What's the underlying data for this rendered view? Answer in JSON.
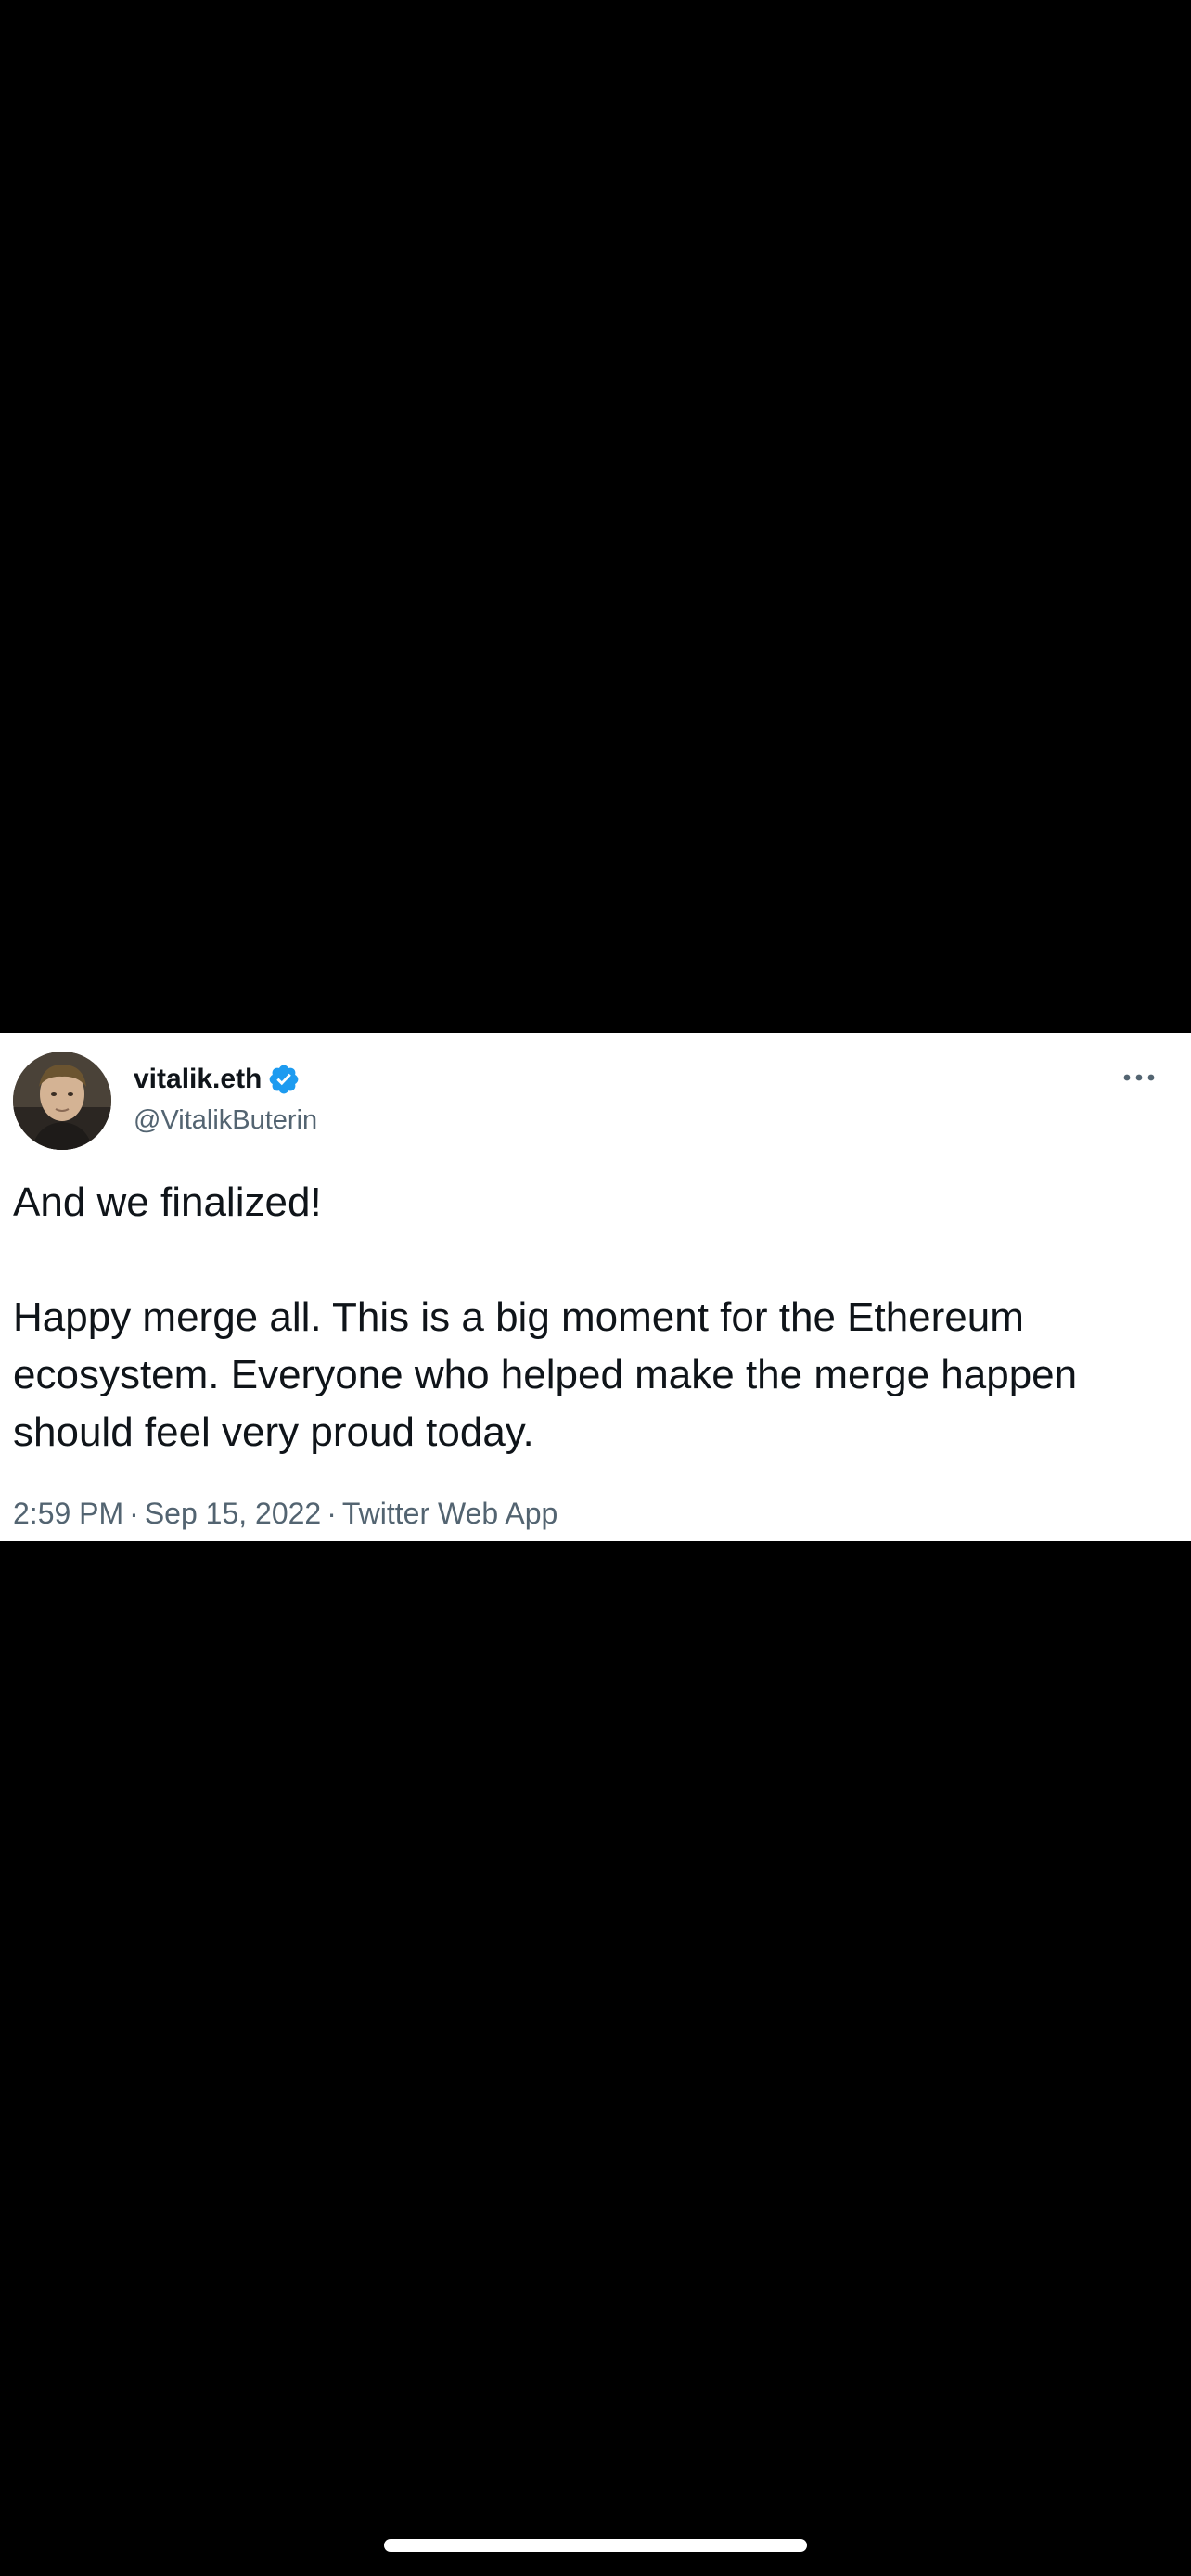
{
  "tweet": {
    "author": {
      "display_name": "vitalik.eth",
      "handle": "@VitalikButerin",
      "verified": true
    },
    "text": {
      "paragraph_1": "And we finalized!",
      "paragraph_2": "Happy merge all. This is a big moment for the Ethereum ecosystem. Everyone who helped make the merge happen should feel very proud today."
    },
    "meta": {
      "time": "2:59 PM",
      "separator": "·",
      "date": "Sep 15, 2022",
      "source": "Twitter Web App"
    },
    "more_icon": "more-horizontal-icon",
    "verified_icon": "verified-badge-icon"
  },
  "colors": {
    "background": "#000000",
    "card": "#ffffff",
    "text_primary": "#0f1419",
    "text_secondary": "#536471",
    "verified_blue": "#1d9bf0"
  }
}
